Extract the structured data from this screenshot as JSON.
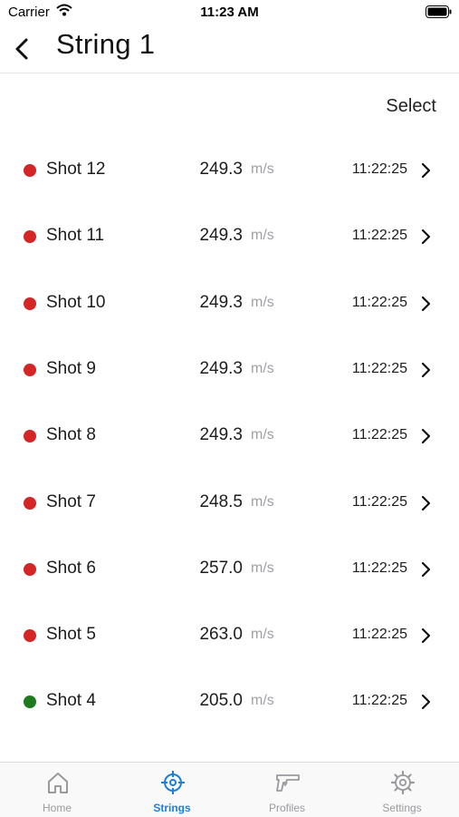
{
  "status_bar": {
    "carrier": "Carrier",
    "time": "11:23 AM"
  },
  "nav": {
    "title": "String 1"
  },
  "toolbar": {
    "select_label": "Select"
  },
  "shots": [
    {
      "name": "Shot 12",
      "velocity": "249.3",
      "unit": "m/s",
      "time": "11:22:25",
      "status_color": "#d42527"
    },
    {
      "name": "Shot 11",
      "velocity": "249.3",
      "unit": "m/s",
      "time": "11:22:25",
      "status_color": "#d42527"
    },
    {
      "name": "Shot 10",
      "velocity": "249.3",
      "unit": "m/s",
      "time": "11:22:25",
      "status_color": "#d42527"
    },
    {
      "name": "Shot 9",
      "velocity": "249.3",
      "unit": "m/s",
      "time": "11:22:25",
      "status_color": "#d42527"
    },
    {
      "name": "Shot 8",
      "velocity": "249.3",
      "unit": "m/s",
      "time": "11:22:25",
      "status_color": "#d42527"
    },
    {
      "name": "Shot 7",
      "velocity": "248.5",
      "unit": "m/s",
      "time": "11:22:25",
      "status_color": "#d42527"
    },
    {
      "name": "Shot 6",
      "velocity": "257.0",
      "unit": "m/s",
      "time": "11:22:25",
      "status_color": "#d42527"
    },
    {
      "name": "Shot 5",
      "velocity": "263.0",
      "unit": "m/s",
      "time": "11:22:25",
      "status_color": "#d42527"
    },
    {
      "name": "Shot 4",
      "velocity": "205.0",
      "unit": "m/s",
      "time": "11:22:25",
      "status_color": "#1e7a1e"
    }
  ],
  "tabs": [
    {
      "label": "Home",
      "icon": "home-icon",
      "active": false
    },
    {
      "label": "Strings",
      "icon": "crosshair-icon",
      "active": true
    },
    {
      "label": "Profiles",
      "icon": "pistol-icon",
      "active": false
    },
    {
      "label": "Settings",
      "icon": "gear-icon",
      "active": false
    }
  ],
  "colors": {
    "accent": "#1a7fe0",
    "inactive_tab": "#9a9a9e",
    "unit_text": "#a0a0a5"
  }
}
